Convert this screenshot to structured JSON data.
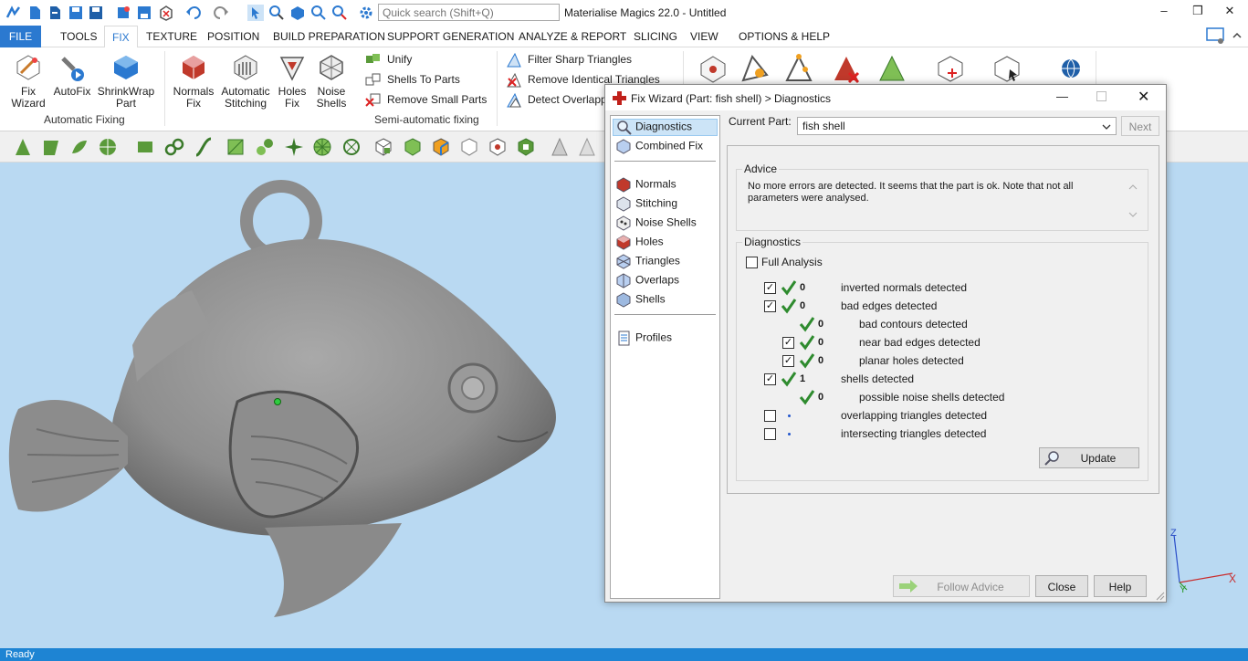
{
  "app": {
    "title": "Materialise Magics 22.0 - Untitled",
    "search_placeholder": "Quick search (Shift+Q)"
  },
  "window_controls": {
    "minimize": "–",
    "restore": "❒",
    "close": "✕"
  },
  "menu": {
    "file": "FILE",
    "items": [
      "TOOLS",
      "FIX",
      "TEXTURE",
      "POSITION",
      "BUILD PREPARATION",
      "SUPPORT GENERATION",
      "ANALYZE & REPORT",
      "SLICING",
      "VIEW",
      "OPTIONS & HELP"
    ],
    "active": "FIX"
  },
  "ribbon": {
    "automatic": {
      "buttons": [
        {
          "line1": "Fix",
          "line2": "Wizard"
        },
        {
          "line1": "AutoFix",
          "line2": ""
        },
        {
          "line1": "ShrinkWrap",
          "line2": "Part"
        }
      ],
      "group_label": "Automatic Fixing"
    },
    "semi": {
      "buttons": [
        {
          "line1": "Normals",
          "line2": "Fix"
        },
        {
          "line1": "Automatic",
          "line2": "Stitching"
        },
        {
          "line1": "Holes",
          "line2": "Fix"
        },
        {
          "line1": "Noise",
          "line2": "Shells"
        }
      ],
      "small": [
        "Unify",
        "Shells To Parts",
        "Remove Small Parts"
      ],
      "group_label": "Semi-automatic fixing"
    },
    "triangles": {
      "small": [
        "Filter Sharp Triangles",
        "Remove Identical Triangles",
        "Detect Overlapping"
      ]
    }
  },
  "status": {
    "text": "Ready"
  },
  "axes": {
    "z": "Z",
    "y": "Y",
    "x": "X"
  },
  "dialog": {
    "title": "Fix Wizard (Part: fish shell) > Diagnostics",
    "nav_top": [
      "Diagnostics",
      "Combined Fix"
    ],
    "nav_items": [
      "Normals",
      "Stitching",
      "Noise Shells",
      "Holes",
      "Triangles",
      "Overlaps",
      "Shells"
    ],
    "nav_bottom": [
      "Profiles"
    ],
    "current_part_label": "Current Part:",
    "current_part_value": "fish shell",
    "next": "Next",
    "advice_title": "Advice",
    "advice_text": "No more errors are detected. It seems that the part is ok. Note that not all parameters were analysed.",
    "diagnostics_title": "Diagnostics",
    "full_analysis": "Full Analysis",
    "rows": [
      {
        "count": "0",
        "label": "inverted normals detected",
        "checked": true,
        "indent": 0,
        "status": "ok"
      },
      {
        "count": "0",
        "label": "bad edges detected",
        "checked": true,
        "indent": 0,
        "status": "ok"
      },
      {
        "count": "0",
        "label": "bad contours detected",
        "checked": null,
        "indent": 1,
        "status": "ok"
      },
      {
        "count": "0",
        "label": "near bad edges detected",
        "checked": true,
        "indent": 1,
        "status": "ok"
      },
      {
        "count": "0",
        "label": "planar holes detected",
        "checked": true,
        "indent": 1,
        "status": "ok"
      },
      {
        "count": "1",
        "label": "shells detected",
        "checked": true,
        "indent": 0,
        "status": "ok"
      },
      {
        "count": "0",
        "label": "possible noise shells detected",
        "checked": null,
        "indent": 1,
        "status": "ok"
      },
      {
        "count": "",
        "label": "overlapping triangles detected",
        "checked": false,
        "indent": 0,
        "status": "none"
      },
      {
        "count": "",
        "label": "intersecting triangles detected",
        "checked": false,
        "indent": 0,
        "status": "none"
      }
    ],
    "update": "Update",
    "follow_advice": "Follow Advice",
    "close": "Close",
    "help": "Help"
  },
  "colors": {
    "accent": "#2b79d0",
    "viewport": "#b9d9f2",
    "status_bar": "#1e84d3",
    "check": "#2e8b2e"
  }
}
